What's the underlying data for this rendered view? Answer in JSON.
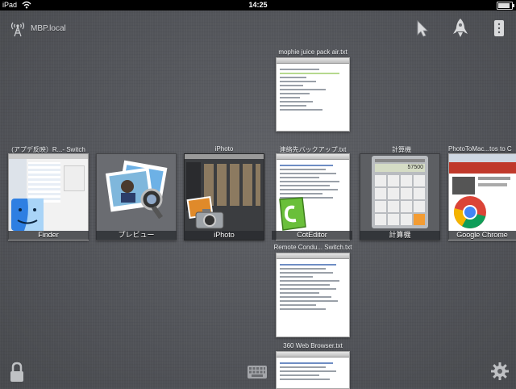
{
  "status_bar": {
    "device": "iPad",
    "time": "14:25",
    "battery_level": 0.85
  },
  "header": {
    "host_name": "MBP.local",
    "icons": [
      "antenna-icon",
      "cursor-arrow-icon",
      "rocket-icon",
      "menu-icon"
    ]
  },
  "apps": [
    {
      "name": "Finder",
      "window_title": "(アプデ反映）R...- Switch"
    },
    {
      "name": "プレビュー",
      "window_title": ""
    },
    {
      "name": "iPhoto",
      "window_title": "iPhoto"
    },
    {
      "name": "CotEditor",
      "window_title": "連絡先バックアップ.txt"
    },
    {
      "name": "計算機",
      "window_title": "計算機",
      "display_value": "57500"
    },
    {
      "name": "Google Chrome",
      "window_title": "PhotoToMac...tos to C"
    }
  ],
  "cot_editor_windows": [
    {
      "title": "mophie juice pack air.txt"
    },
    {
      "title": "連絡先バックアップ.txt"
    },
    {
      "title": "Remote Condu... Switch.txt"
    },
    {
      "title": "360 Web Browser.txt"
    }
  ],
  "footer": {
    "icons": [
      "lock-icon",
      "keyboard-icon",
      "gear-icon"
    ]
  },
  "colors": {
    "background": "#56585d",
    "label_bar": "#2a2c30",
    "editor_green": "#6abf3a"
  }
}
